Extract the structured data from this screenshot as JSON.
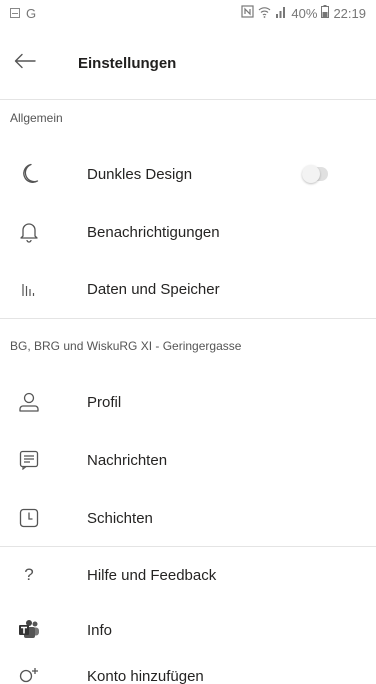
{
  "status_bar": {
    "carrier": "G",
    "battery_percent": "40%",
    "time": "22:19"
  },
  "header": {
    "title": "Einstellungen"
  },
  "sections": [
    {
      "label": "Allgemein",
      "items": [
        {
          "label": "Dunkles Design",
          "icon": "moon-icon",
          "toggle_on": false
        },
        {
          "label": "Benachrichtigungen",
          "icon": "bell-icon"
        },
        {
          "label": "Daten und Speicher",
          "icon": "data-bars-icon"
        }
      ]
    },
    {
      "label": "BG, BRG und WiskuRG XI - Geringergasse",
      "items": [
        {
          "label": "Profil",
          "icon": "person-icon"
        },
        {
          "label": "Nachrichten",
          "icon": "message-icon"
        },
        {
          "label": "Schichten",
          "icon": "shifts-clock-icon"
        }
      ]
    },
    {
      "label": "",
      "items": [
        {
          "label": "Hilfe und Feedback",
          "icon": "question-icon"
        },
        {
          "label": "Info",
          "icon": "teams-logo-icon"
        },
        {
          "label": "Konto hinzufügen",
          "icon": "add-account-icon"
        }
      ]
    }
  ],
  "colors": {
    "text": "#252423",
    "secondary_text": "#555555",
    "divider": "#e4e4e4",
    "toggle_track": "#e0e0e0",
    "teams_purple": "#5b5fc7"
  }
}
